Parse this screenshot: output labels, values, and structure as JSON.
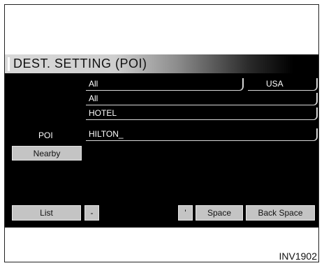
{
  "title": "DEST. SETTING (POI)",
  "fields": {
    "state": "All",
    "country": "USA",
    "city": "All",
    "category": "HOTEL",
    "poi_label": "POI",
    "poi_name": "HILTON_"
  },
  "buttons": {
    "nearby": "Nearby",
    "list": "List",
    "dash": "-",
    "apostrophe": "'",
    "space": "Space",
    "back_space": "Back Space"
  },
  "figure_ref": "INV1902"
}
